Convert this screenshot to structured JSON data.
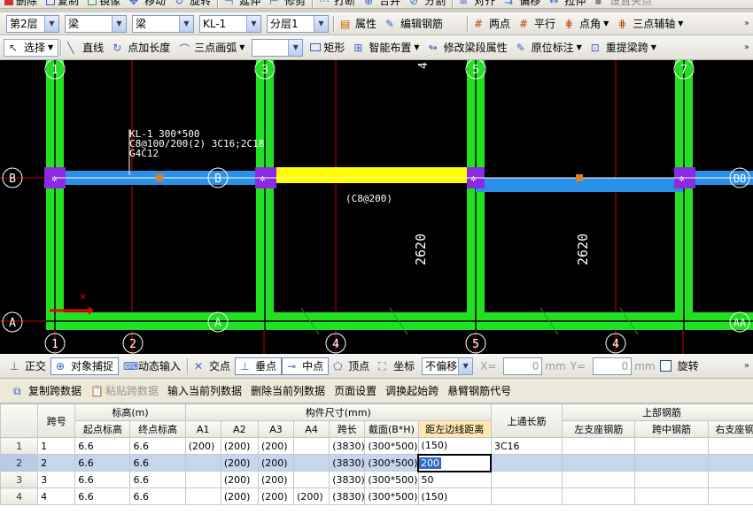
{
  "toolbar1": {
    "delete": "删除",
    "copy": "复制",
    "mirror": "镜像",
    "move": "移动",
    "rotate": "旋转",
    "extend": "延伸",
    "trim": "修剪",
    "break": "打断",
    "merge": "合并",
    "split": "分割",
    "align": "对齐",
    "offset": "偏移",
    "stretch": "拉伸",
    "set_grip": "设置夹点"
  },
  "toolbar2": {
    "floor": "第2层",
    "category": "梁",
    "type": "梁",
    "name": "KL-1",
    "layer": "分层1",
    "properties": "属性",
    "edit_rebar": "编辑钢筋",
    "two_points": "两点",
    "parallel": "平行",
    "point_angle": "点角",
    "three_point_axis": "三点辅轴"
  },
  "toolbar3": {
    "select": "选择",
    "line": "直线",
    "point_length": "点加长度",
    "three_point_arc": "三点画弧",
    "blank_select": "",
    "rectangle": "矩形",
    "smart_layout": "智能布置",
    "modify_span_props": "修改梁段属性",
    "in_place_mark": "原位标注",
    "re_extract_span": "重提梁跨"
  },
  "drawing": {
    "axes_top": [
      "1",
      "3",
      "5",
      "7"
    ],
    "axes_bottom": [
      "1",
      "2",
      "A",
      "4",
      "5",
      "4",
      "AA"
    ],
    "left_labels": [
      "B",
      "A"
    ],
    "right_label_b": "BB",
    "mid_label_b": "B",
    "mid_label_a": "A",
    "beam_annotation": [
      "KL-1 300*500",
      "C8@100/200(2) 3C16;2C18",
      "G4C12"
    ],
    "stirrup_label": "(C8@200)",
    "dim_labels": [
      "2620",
      "2620"
    ],
    "top_dim_fragment": "4"
  },
  "snapbar": {
    "ortho": "正交",
    "object_snap": "对象捕捉",
    "dynamic_input": "动态输入",
    "intersection": "交点",
    "perpendicular": "垂点",
    "midpoint": "中点",
    "vertex": "顶点",
    "coordinate": "坐标",
    "offset_mode": "不偏移",
    "x_label": "X=",
    "x_value": "0",
    "y_label": "Y=",
    "y_value": "0",
    "unit": "mm",
    "rotate": "旋转"
  },
  "gridtool": {
    "copy_span": "复制跨数据",
    "paste_span": "粘贴跨数据",
    "input_col": "输入当前列数据",
    "delete_col": "删除当前列数据",
    "page_setup": "页面设置",
    "swap_start": "调换起始跨",
    "cantilever_code": "悬臂钢筋代号"
  },
  "table": {
    "h_span": "跨号",
    "h_elev": "标高(m)",
    "h_start_elev": "起点标高",
    "h_end_elev": "终点标高",
    "h_dims": "构件尺寸(mm)",
    "h_a1": "A1",
    "h_a2": "A2",
    "h_a3": "A3",
    "h_a4": "A4",
    "h_span_len": "跨长",
    "h_section": "截面(B*H)",
    "h_left_dist": "距左边线距离",
    "h_top_through": "上通长筋",
    "h_top_rebar": "上部钢筋",
    "h_left_support": "左支座钢筋",
    "h_mid_rebar": "跨中钢筋",
    "h_right_support": "右支座钢",
    "rows": [
      {
        "idx": "1",
        "span": "1",
        "se": "6.6",
        "ee": "6.6",
        "a1": "(200)",
        "a2": "(200)",
        "a3": "(200)",
        "a4": "",
        "len": "(3830)",
        "sec": "(300*500)",
        "dist": "(150)",
        "top": "3C16"
      },
      {
        "idx": "2",
        "span": "2",
        "se": "6.6",
        "ee": "6.6",
        "a1": "",
        "a2": "(200)",
        "a3": "(200)",
        "a4": "",
        "len": "(3830)",
        "sec": "(300*500)",
        "dist": "200",
        "top": ""
      },
      {
        "idx": "3",
        "span": "3",
        "se": "6.6",
        "ee": "6.6",
        "a1": "",
        "a2": "(200)",
        "a3": "(200)",
        "a4": "",
        "len": "(3830)",
        "sec": "(300*500)",
        "dist": "50",
        "top": ""
      },
      {
        "idx": "4",
        "span": "4",
        "se": "6.6",
        "ee": "6.6",
        "a1": "",
        "a2": "(200)",
        "a3": "(200)",
        "a4": "(200)",
        "len": "(3830)",
        "sec": "(300*500)",
        "dist": "(150)",
        "top": ""
      }
    ]
  }
}
